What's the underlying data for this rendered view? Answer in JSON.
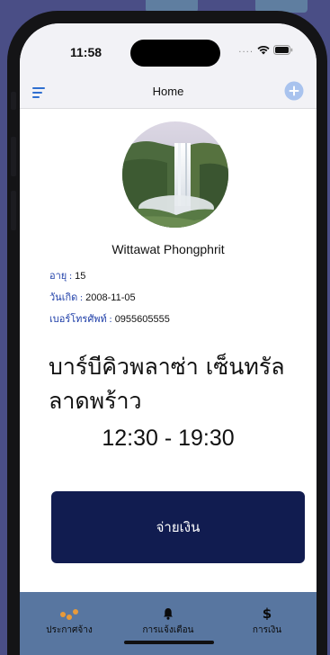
{
  "status_bar": {
    "time": "11:58",
    "signal_dots": "....",
    "icons": [
      "wifi-icon",
      "battery-icon"
    ]
  },
  "nav_bar": {
    "title": "Home",
    "left_icon": "menu-icon",
    "right_icon": "add-circle-icon"
  },
  "profile": {
    "avatar": "waterfall-photo",
    "name": "Wittawat Phongphrit",
    "fields": [
      {
        "label": "อายุ :",
        "value": "15"
      },
      {
        "label": "วันเกิด :",
        "value": "2008-11-05"
      },
      {
        "label": "เบอร์โทรศัพท์ :",
        "value": "0955605555"
      }
    ]
  },
  "job": {
    "venue": "บาร์บีคิวพลาซ่า เซ็นทรัล ลาดพร้าว",
    "shift_time": "12:30 - 19:30",
    "pay_button_label": "จ่ายเงิน"
  },
  "tab_bar": {
    "items": [
      {
        "label": "ประกาศจ้าง",
        "icon": "dots-icon"
      },
      {
        "label": "การแจ้งเตือน",
        "icon": "bell-icon"
      },
      {
        "label": "การเงิน",
        "icon": "dollar-icon"
      }
    ]
  },
  "colors": {
    "accent_blue": "#2f6fd0",
    "label_blue": "#1f3fa8",
    "pay_button": "#111c50",
    "tab_bar": "#5876a0",
    "tab_active_icon": "#e89a3a"
  }
}
